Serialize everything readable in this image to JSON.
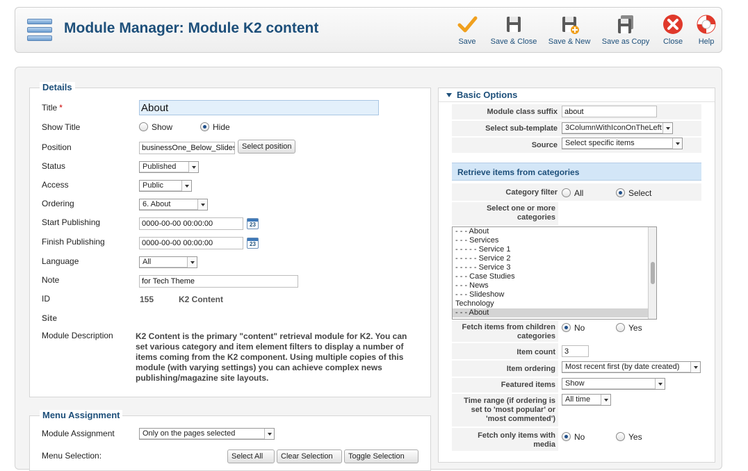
{
  "header": {
    "title": "Module Manager: Module K2 content",
    "buttons": [
      {
        "label": "Save",
        "icon": "checkmark-icon"
      },
      {
        "label": "Save & Close",
        "icon": "floppy-icon"
      },
      {
        "label": "Save & New",
        "icon": "floppy-plus-icon"
      },
      {
        "label": "Save as Copy",
        "icon": "floppy-copy-icon"
      },
      {
        "label": "Close",
        "icon": "close-icon"
      },
      {
        "label": "Help",
        "icon": "lifebuoy-icon"
      }
    ]
  },
  "details": {
    "legend": "Details",
    "title_label": "Title",
    "title_value": "About",
    "show_title_label": "Show Title",
    "show_title_options": [
      "Show",
      "Hide"
    ],
    "show_title_selected": "Hide",
    "position_label": "Position",
    "position_value": "businessOne_Below_Slidesh",
    "select_position_button": "Select position",
    "status_label": "Status",
    "status_value": "Published",
    "access_label": "Access",
    "access_value": "Public",
    "ordering_label": "Ordering",
    "ordering_value": "6. About",
    "start_publishing_label": "Start Publishing",
    "start_publishing_value": "0000-00-00 00:00:00",
    "finish_publishing_label": "Finish Publishing",
    "finish_publishing_value": "0000-00-00 00:00:00",
    "calendar_icon_text": "23",
    "language_label": "Language",
    "language_value": "All",
    "note_label": "Note",
    "note_value": "for Tech Theme",
    "id_label": "ID",
    "id_value": "155",
    "id_type": "K2 Content",
    "site_label": "Site",
    "module_description_label": "Module Description",
    "module_description": "K2 Content is the primary \"content\" retrieval module for K2. You can set various category and item element filters to display a number of items coming from the K2 component. Using multiple copies of this module (with varying settings) you can achieve complex news publishing/magazine site layouts."
  },
  "menu_assignment": {
    "legend": "Menu Assignment",
    "module_assignment_label": "Module Assignment",
    "module_assignment_value": "Only on the pages selected",
    "menu_selection_label": "Menu Selection:",
    "buttons": [
      "Select All",
      "Clear Selection",
      "Toggle Selection"
    ]
  },
  "basic_options": {
    "header": "Basic Options",
    "module_class_suffix_label": "Module class suffix",
    "module_class_suffix_value": "about",
    "sub_template_label": "Select sub-template",
    "sub_template_value": "3ColumnWithIconOnTheLeft",
    "source_label": "Source",
    "source_value": "Select specific items",
    "retrieve_header": "Retrieve items from categories",
    "category_filter_label": "Category filter",
    "category_filter_options": [
      "All",
      "Select"
    ],
    "category_filter_selected": "Select",
    "select_categories_label": "Select one or more categories",
    "categories": [
      "- - - About",
      "- - - Services",
      "- - - - - Service 1",
      "- - - - - Service 2",
      "- - - - - Service 3",
      "- - - Case Studies",
      "- - - News",
      "- - - Slideshow",
      "Technology",
      "- - - About"
    ],
    "categories_selected_index": 9,
    "fetch_children_label": "Fetch items from children categories",
    "fetch_children_options": [
      "No",
      "Yes"
    ],
    "fetch_children_selected": "No",
    "item_count_label": "Item count",
    "item_count_value": "3",
    "item_ordering_label": "Item ordering",
    "item_ordering_value": "Most recent first (by date created)",
    "featured_items_label": "Featured items",
    "featured_items_value": "Show",
    "time_range_label": "Time range (if ordering is set to 'most popular' or 'most commented')",
    "time_range_value": "All time",
    "fetch_media_label": "Fetch only items with media",
    "fetch_media_options": [
      "No",
      "Yes"
    ],
    "fetch_media_selected": "No"
  },
  "colors": {
    "title_blue": "#1d4f7a",
    "section_blue": "#d3e6f7",
    "close_red": "#e0392b",
    "save_orange": "#f0a01e"
  }
}
